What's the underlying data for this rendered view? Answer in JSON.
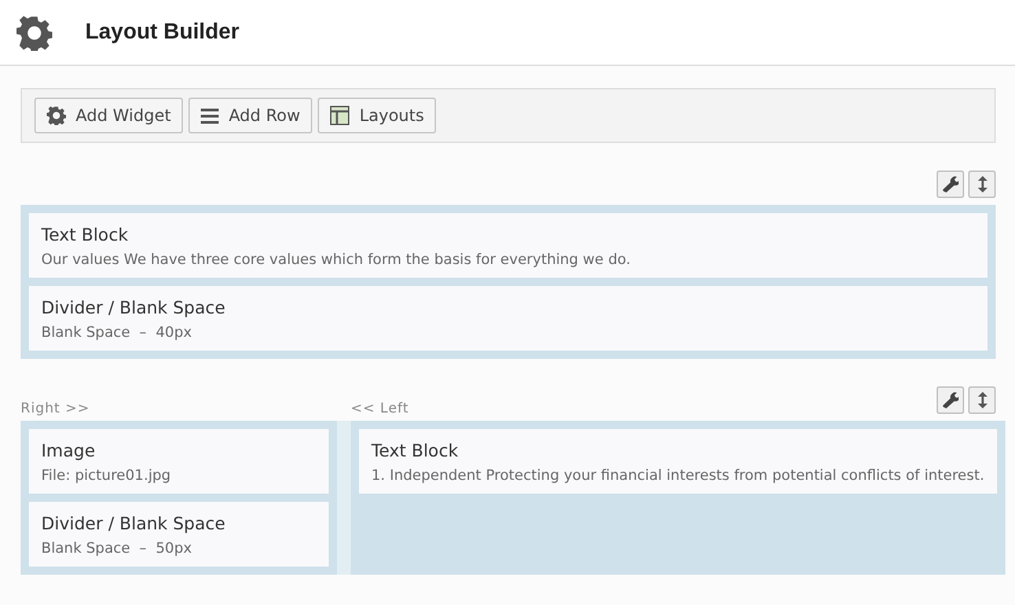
{
  "header": {
    "title": "Layout Builder"
  },
  "toolbar": [
    {
      "kind": "widget",
      "label": "Add Widget"
    },
    {
      "kind": "row",
      "label": "Add Row"
    },
    {
      "kind": "layouts",
      "label": "Layouts"
    }
  ],
  "rows": [
    {
      "cells": [
        {
          "widgets": [
            {
              "title": "Text Block",
              "summary": "Our values We have three core values which form the basis for everything we do."
            },
            {
              "title": "Divider / Blank Space",
              "summary": "Blank Space  –  40px"
            }
          ]
        }
      ]
    },
    {
      "cells": [
        {
          "label": "Right >>",
          "widgets": [
            {
              "title": "Image",
              "summary": "File: picture01.jpg"
            },
            {
              "title": "Divider / Blank Space",
              "summary": "Blank Space  –  50px"
            }
          ]
        },
        {
          "label": "<< Left",
          "widgets": [
            {
              "title": "Text Block",
              "summary": "1. Independent Protecting your financial interests from potential conflicts of interest."
            }
          ]
        }
      ]
    }
  ]
}
